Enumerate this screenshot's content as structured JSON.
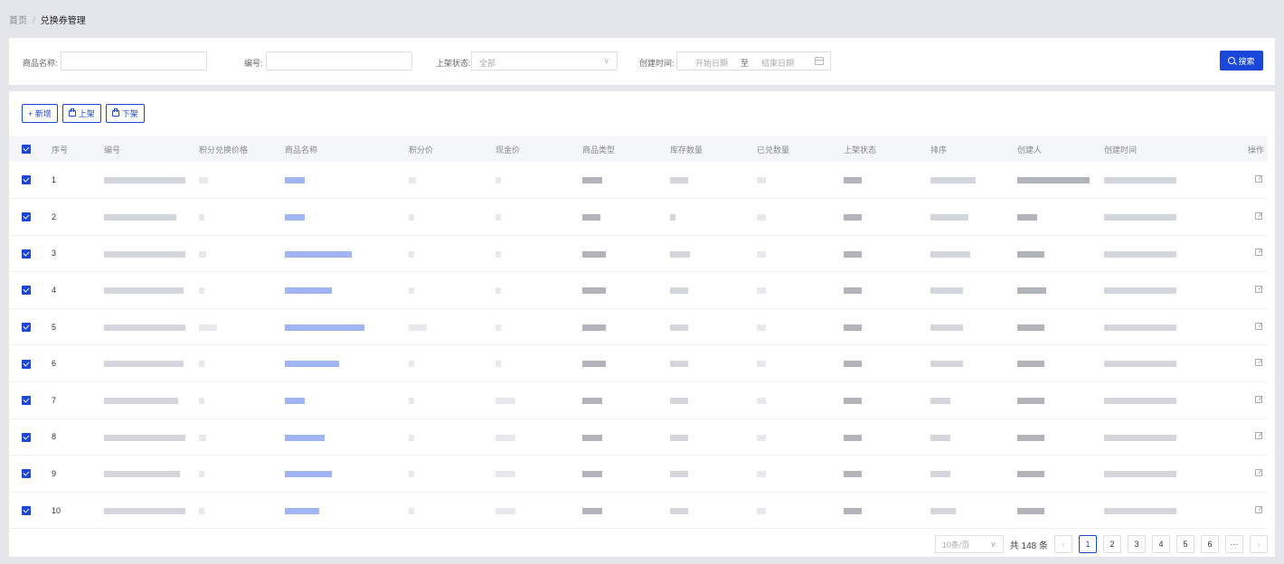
{
  "breadcrumb": {
    "home": "首页",
    "separator": "/",
    "current": "兑换券管理"
  },
  "filters": {
    "name_label": "商品名称:",
    "code_label": "编号:",
    "status_label": "上架状态:",
    "status_value": "全部",
    "created_label": "创建时间:",
    "start_placeholder": "开始日期",
    "range_sep": "至",
    "end_placeholder": "结束日期",
    "search_button": "搜索"
  },
  "toolbar": {
    "add": "+ 新增",
    "list": "上架",
    "unlist": "下架"
  },
  "table": {
    "headers": [
      "序号",
      "编号",
      "积分兑换价格",
      "商品名称",
      "积分价",
      "现金价",
      "商品类型",
      "库存数量",
      "已兑数量",
      "上架状态",
      "排序",
      "创建人",
      "创建时间",
      "操作"
    ],
    "rows": [
      {
        "no": "1"
      },
      {
        "no": "2"
      },
      {
        "no": "3"
      },
      {
        "no": "4"
      },
      {
        "no": "5"
      },
      {
        "no": "6"
      },
      {
        "no": "7"
      },
      {
        "no": "8"
      },
      {
        "no": "9"
      },
      {
        "no": "10"
      }
    ]
  },
  "pagination": {
    "page_size": "10条/页",
    "total": "共 148 条",
    "pages": [
      "1",
      "2",
      "3",
      "4",
      "5",
      "6"
    ],
    "ellipsis": "···",
    "current": "1"
  },
  "colors": {
    "accent": "#1a47d9",
    "background": "#e4e6ec"
  }
}
